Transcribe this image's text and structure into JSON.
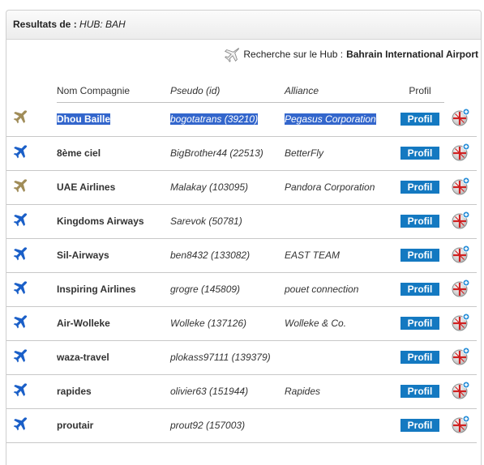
{
  "header": {
    "label": "Resultats de :",
    "hub": "HUB: BAH"
  },
  "search": {
    "prefix": "Recherche sur le Hub :",
    "airport": "Bahrain International Airport"
  },
  "columns": {
    "name": "Nom Compagnie",
    "pseudo": "Pseudo (id)",
    "alliance": "Alliance",
    "profil": "Profil"
  },
  "profil_button_label": "Profil",
  "colors": {
    "plane_gold": "#a08c58",
    "plane_blue": "#1a5fc8",
    "button_blue": "#1479c1",
    "selection": "#3366cc"
  },
  "rows": [
    {
      "icon": "gold-plane-icon",
      "name": "Dhou Baille",
      "pseudo": "bogotatrans (39210)",
      "alliance": "Pegasus Corporation",
      "selected": true
    },
    {
      "icon": "blue-plane-icon",
      "name": "8ème ciel",
      "pseudo": "BigBrother44 (22513)",
      "alliance": "BetterFly"
    },
    {
      "icon": "gold-plane-icon",
      "name": "UAE Airlines",
      "pseudo": "Malakay (103095)",
      "alliance": "Pandora Corporation"
    },
    {
      "icon": "blue-plane-icon",
      "name": "Kingdoms Airways",
      "pseudo": "Sarevok (50781)",
      "alliance": ""
    },
    {
      "icon": "blue-plane-icon",
      "name": "Sil-Airways",
      "pseudo": "ben8432 (133082)",
      "alliance": "EAST TEAM"
    },
    {
      "icon": "blue-plane-icon",
      "name": "Inspiring Airlines",
      "pseudo": "grogre (145809)",
      "alliance": "pouet connection"
    },
    {
      "icon": "blue-plane-icon",
      "name": "Air-Wolleke",
      "pseudo": "Wolleke (137126)",
      "alliance": "Wolleke & Co."
    },
    {
      "icon": "blue-plane-icon",
      "name": "waza-travel",
      "pseudo": "plokass97111 (139379)",
      "alliance": ""
    },
    {
      "icon": "blue-plane-icon",
      "name": "rapides",
      "pseudo": "olivier63 (151944)",
      "alliance": "Rapides"
    },
    {
      "icon": "blue-plane-icon",
      "name": "proutair",
      "pseudo": "prout92 (157003)",
      "alliance": ""
    }
  ]
}
